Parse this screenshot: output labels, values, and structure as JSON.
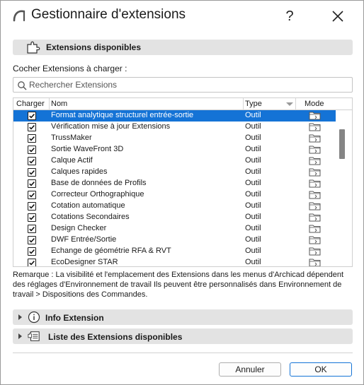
{
  "window": {
    "title": "Gestionnaire d'extensions",
    "help_label": "?"
  },
  "section": {
    "title": "Extensions disponibles"
  },
  "check_label": "Cocher Extensions à charger :",
  "search": {
    "placeholder": "Rechercher Extensions",
    "value": ""
  },
  "table": {
    "columns": [
      "Charger",
      "Nom",
      "Type",
      "Mode"
    ],
    "rows": [
      {
        "checked": true,
        "name": "Format analytique structurel entrée-sortie",
        "type": "Outil",
        "mode_icon": "folder-icon",
        "selected": true
      },
      {
        "checked": true,
        "name": "Vérification mise à jour Extensions",
        "type": "Outil",
        "mode_icon": "folder-icon"
      },
      {
        "checked": true,
        "name": "TrussMaker",
        "type": "Outil",
        "mode_icon": "folder-icon"
      },
      {
        "checked": true,
        "name": "Sortie WaveFront 3D",
        "type": "Outil",
        "mode_icon": "folder-icon"
      },
      {
        "checked": true,
        "name": "Calque Actif",
        "type": "Outil",
        "mode_icon": "folder-icon"
      },
      {
        "checked": true,
        "name": "Calques rapides",
        "type": "Outil",
        "mode_icon": "folder-icon"
      },
      {
        "checked": true,
        "name": "Base de données de Profils",
        "type": "Outil",
        "mode_icon": "folder-icon"
      },
      {
        "checked": true,
        "name": "Correcteur Orthographique",
        "type": "Outil",
        "mode_icon": "folder-icon"
      },
      {
        "checked": true,
        "name": "Cotation automatique",
        "type": "Outil",
        "mode_icon": "folder-icon"
      },
      {
        "checked": true,
        "name": "Cotations Secondaires",
        "type": "Outil",
        "mode_icon": "folder-icon"
      },
      {
        "checked": true,
        "name": "Design Checker",
        "type": "Outil",
        "mode_icon": "folder-icon"
      },
      {
        "checked": true,
        "name": "DWF Entrée/Sortie",
        "type": "Outil",
        "mode_icon": "folder-icon"
      },
      {
        "checked": true,
        "name": "Echange de géométrie RFA & RVT",
        "type": "Outil",
        "mode_icon": "folder-icon"
      },
      {
        "checked": true,
        "name": "EcoDesigner STAR",
        "type": "Outil",
        "mode_icon": "folder-icon"
      }
    ]
  },
  "remark": "Remarque : La visibilité et l'emplacement des Extensions dans les menus d'Archicad dépendent des réglages d'Environnement de travail Ils peuvent être personnalisés dans Environnement de travail > Dispositions des Commandes.",
  "panels": {
    "info": "Info Extension",
    "list": "Liste des Extensions disponibles"
  },
  "buttons": {
    "cancel": "Annuler",
    "ok": "OK"
  },
  "colors": {
    "selection": "#1473d6",
    "section_bg": "#e3e3e3"
  }
}
